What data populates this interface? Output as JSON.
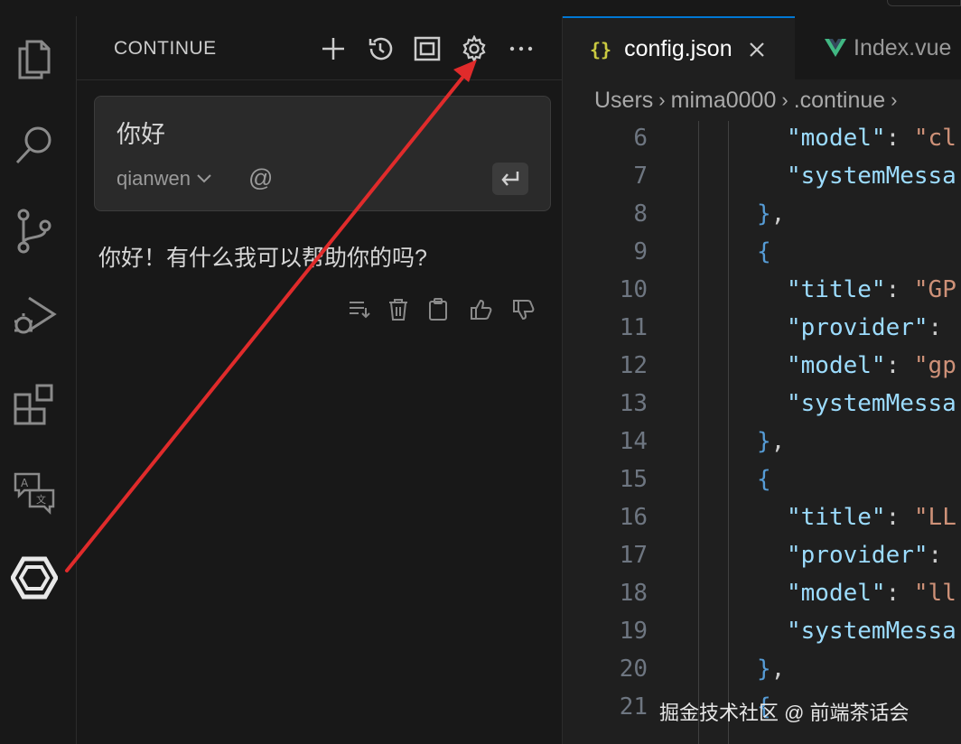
{
  "panel": {
    "title": "CONTINUE",
    "input_text": "你好",
    "model": "qianwen",
    "at_symbol": "@",
    "reply": "你好！有什么我可以帮助你的吗?"
  },
  "tabs": [
    {
      "label": "config.json",
      "icon": "json-braces",
      "active": true
    },
    {
      "label": "Index.vue",
      "icon": "vue-logo",
      "active": false
    }
  ],
  "breadcrumb": [
    "Users",
    "mima0000",
    ".continue"
  ],
  "code_lines": [
    {
      "num": "6",
      "text": "\"model\": \"cl"
    },
    {
      "num": "7",
      "text": "\"systemMessa"
    },
    {
      "num": "8",
      "text": "},"
    },
    {
      "num": "9",
      "text": "{"
    },
    {
      "num": "10",
      "text": "\"title\": \"GP"
    },
    {
      "num": "11",
      "text": "\"provider\":"
    },
    {
      "num": "12",
      "text": "\"model\": \"gp"
    },
    {
      "num": "13",
      "text": "\"systemMessa"
    },
    {
      "num": "14",
      "text": "},"
    },
    {
      "num": "15",
      "text": "{"
    },
    {
      "num": "16",
      "text": "\"title\": \"LL"
    },
    {
      "num": "17",
      "text": "\"provider\":"
    },
    {
      "num": "18",
      "text": "\"model\": \"ll"
    },
    {
      "num": "19",
      "text": "\"systemMessa"
    },
    {
      "num": "20",
      "text": "},"
    },
    {
      "num": "21",
      "text": "{"
    }
  ],
  "watermark": "掘金技术社区 @ 前端茶话会",
  "colors": {
    "key": "#9cdcfe",
    "string": "#ce9178",
    "brace": "#569cd6",
    "accent": "#0078d4",
    "arrow": "#e02b2b"
  }
}
